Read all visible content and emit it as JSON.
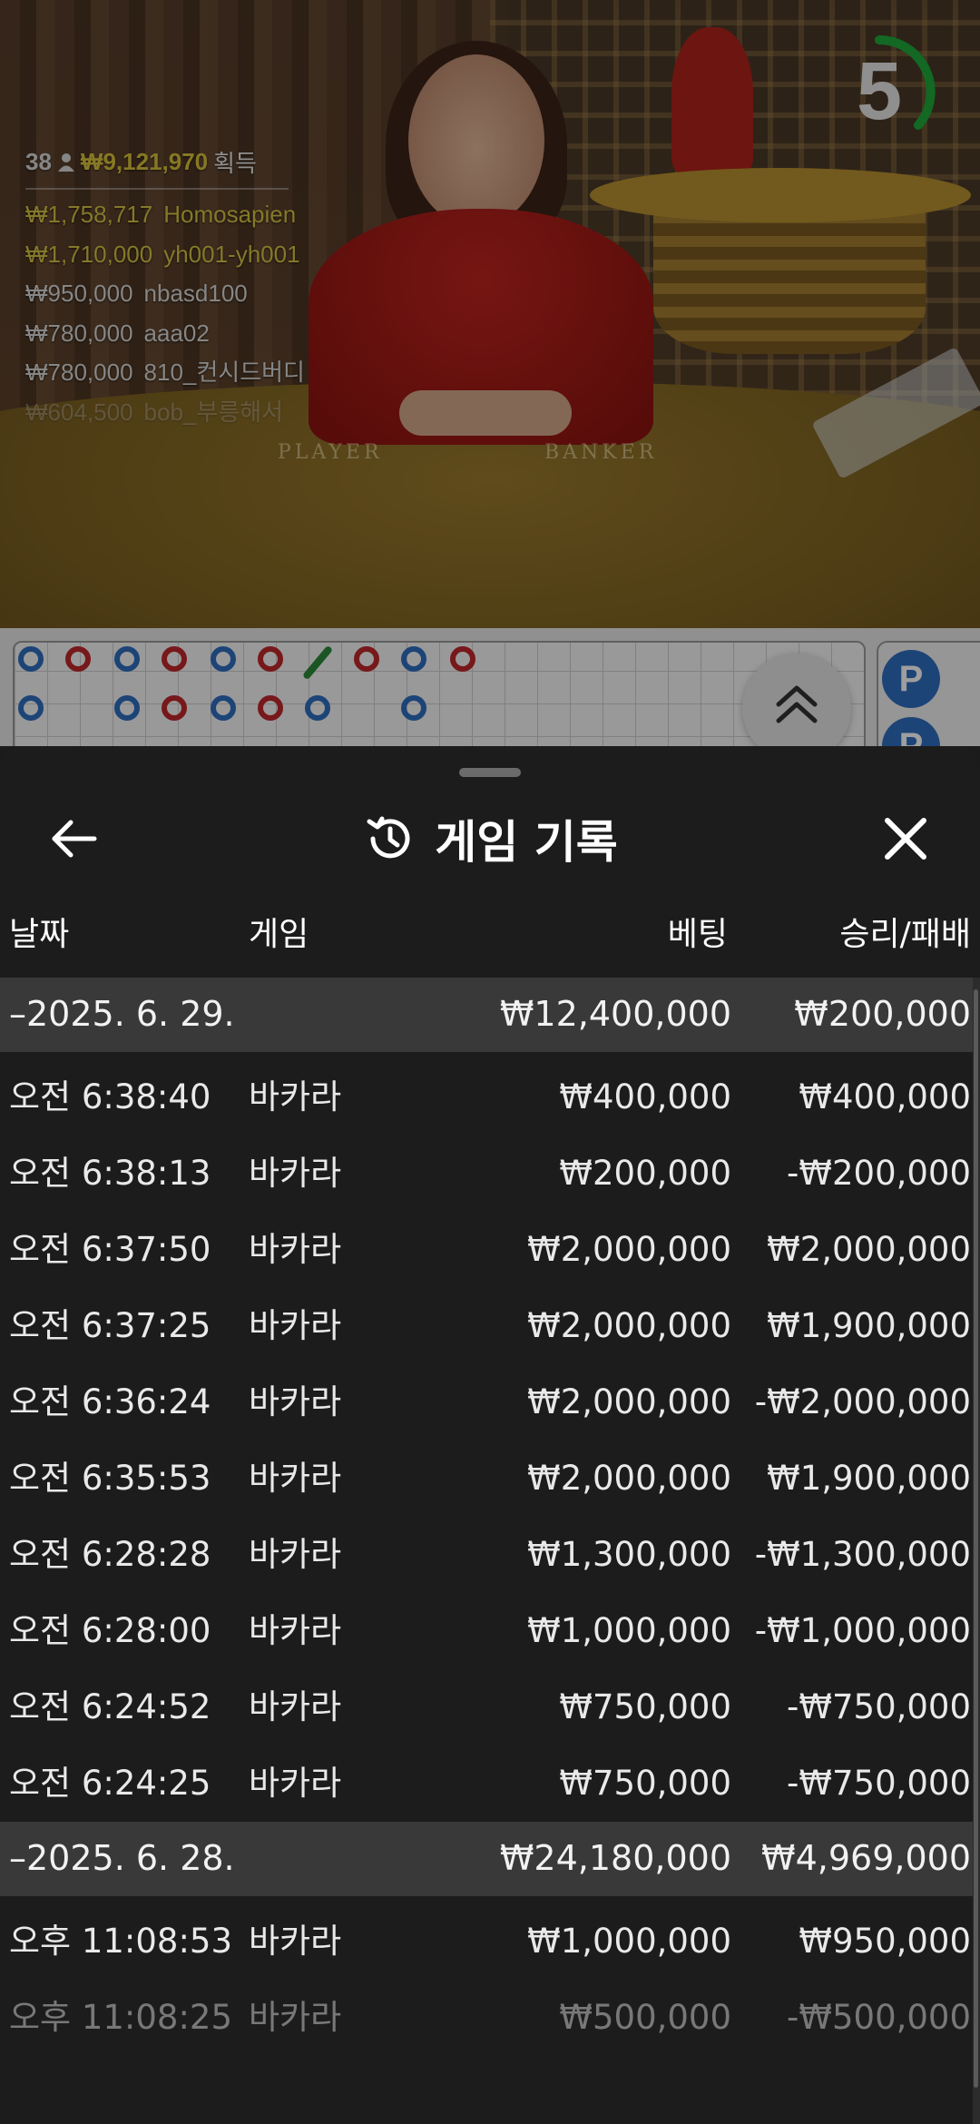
{
  "video": {
    "countdown": "5",
    "table_labels": {
      "player": "PLAYER",
      "banker": "BANKER"
    },
    "winners": {
      "count": "38",
      "total": "₩9,121,970",
      "suffix": "획득",
      "rows": [
        {
          "amount": "₩1,758,717",
          "name": "Homosapien"
        },
        {
          "amount": "₩1,710,000",
          "name": "yh001-yh001"
        },
        {
          "amount": "₩950,000",
          "name": "nbasd100"
        },
        {
          "amount": "₩780,000",
          "name": "aaa02"
        },
        {
          "amount": "₩780,000",
          "name": "810_컨시드버디"
        },
        {
          "amount": "₩604,500",
          "name": "bob_부릉해서"
        }
      ]
    }
  },
  "road": {
    "side_badge": "P"
  },
  "sheet": {
    "title": "게임 기록",
    "columns": {
      "date": "날짜",
      "game": "게임",
      "bet": "베팅",
      "result": "승리/패배"
    },
    "groups": [
      {
        "date": "–2025. 6. 29.",
        "bet": "₩12,400,000",
        "result": "₩200,000",
        "rows": [
          {
            "time": "오전 6:38:40",
            "game": "바카라",
            "bet": "₩400,000",
            "result": "₩400,000"
          },
          {
            "time": "오전 6:38:13",
            "game": "바카라",
            "bet": "₩200,000",
            "result": "-₩200,000"
          },
          {
            "time": "오전 6:37:50",
            "game": "바카라",
            "bet": "₩2,000,000",
            "result": "₩2,000,000"
          },
          {
            "time": "오전 6:37:25",
            "game": "바카라",
            "bet": "₩2,000,000",
            "result": "₩1,900,000"
          },
          {
            "time": "오전 6:36:24",
            "game": "바카라",
            "bet": "₩2,000,000",
            "result": "-₩2,000,000"
          },
          {
            "time": "오전 6:35:53",
            "game": "바카라",
            "bet": "₩2,000,000",
            "result": "₩1,900,000"
          },
          {
            "time": "오전 6:28:28",
            "game": "바카라",
            "bet": "₩1,300,000",
            "result": "-₩1,300,000"
          },
          {
            "time": "오전 6:28:00",
            "game": "바카라",
            "bet": "₩1,000,000",
            "result": "-₩1,000,000"
          },
          {
            "time": "오전 6:24:52",
            "game": "바카라",
            "bet": "₩750,000",
            "result": "-₩750,000"
          },
          {
            "time": "오전 6:24:25",
            "game": "바카라",
            "bet": "₩750,000",
            "result": "-₩750,000"
          }
        ]
      },
      {
        "date": "–2025. 6. 28.",
        "bet": "₩24,180,000",
        "result": "₩4,969,000",
        "rows": [
          {
            "time": "오후 11:08:53",
            "game": "바카라",
            "bet": "₩1,000,000",
            "result": "₩950,000"
          },
          {
            "time": "오후 11:08:25",
            "game": "바카라",
            "bet": "₩500,000",
            "result": "-₩500,000"
          }
        ]
      }
    ]
  },
  "colors": {
    "gold": "#d6c344",
    "countdown_ring": "#1fa83a",
    "banker": "#c0272d",
    "player": "#2f6fc0",
    "tie": "#2d8a3a"
  }
}
